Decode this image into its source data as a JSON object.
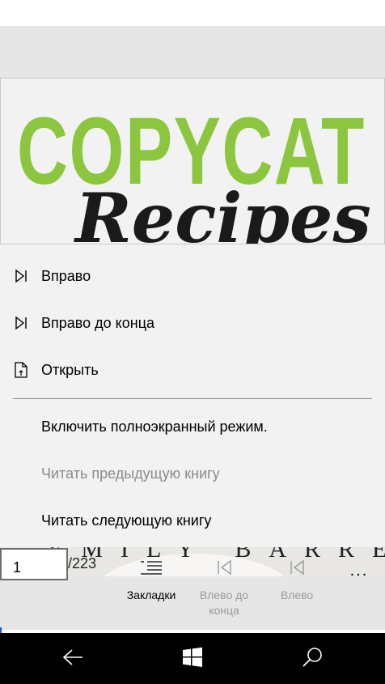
{
  "cover": {
    "title": "COPYCAT",
    "subtitle": "Recipes",
    "author": "EMILY BARREL",
    "title_color": "#8cc63f"
  },
  "menu": {
    "items": [
      {
        "label": "Вправо",
        "icon": "skip-right-icon",
        "enabled": true
      },
      {
        "label": "Вправо до конца",
        "icon": "skip-end-icon",
        "enabled": true
      },
      {
        "label": "Открыть",
        "icon": "open-file-icon",
        "enabled": true
      },
      {
        "label": "Включить полноэкранный режим.",
        "enabled": true
      },
      {
        "label": "Читать предыдущую книгу",
        "enabled": false
      },
      {
        "label": "Читать следующую книгу",
        "enabled": true
      }
    ]
  },
  "pager": {
    "current_page": "1",
    "total": "/223"
  },
  "appbar": {
    "bookmarks_label": "Закладки",
    "left_to_start_label": "Влево до конца",
    "left_label": "Влево",
    "more_label": "..."
  },
  "navbar": {
    "back_icon": "back-arrow-icon",
    "start_icon": "windows-start-icon",
    "search_icon": "search-icon"
  }
}
